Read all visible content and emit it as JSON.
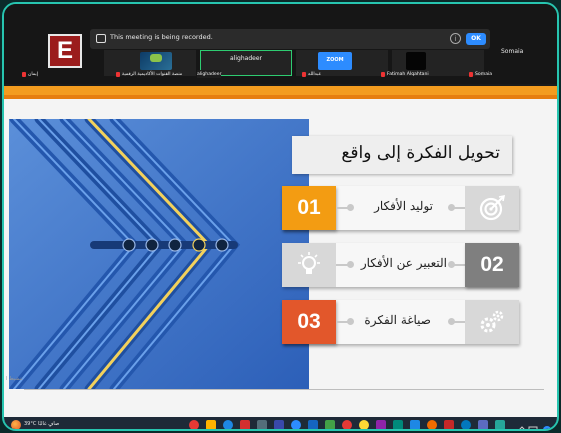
{
  "zoom": {
    "logo_letter": "E",
    "recording_notice": "This meeting is being recorded.",
    "info_symbol": "i",
    "ok_label": "OK",
    "tiles": [
      {
        "center_label": "",
        "name": "منصة القنوات الأكاديمية الرقمية"
      },
      {
        "center_label": "alighadeer",
        "name": "alighadeer"
      },
      {
        "center_label": "ZOOM",
        "name": "عبدالله"
      },
      {
        "center_label": "",
        "name": "Fatimah Alqahtani"
      },
      {
        "center_label": "Somaia",
        "name": "Somaia"
      }
    ],
    "left_name": "إيمان"
  },
  "slide": {
    "title": "تحويل الفكرة إلى واقع",
    "cards": [
      {
        "number": "01",
        "label": "توليد الأفكار",
        "color": "#f39c12",
        "icon": "target-icon"
      },
      {
        "number": "02",
        "label": "التعبير عن الأفكار",
        "color": "#7f7f7f",
        "icon": "lightbulb-icon"
      },
      {
        "number": "03",
        "label": "صياغة الفكرة",
        "color": "#e2572b",
        "icon": "gears-icon"
      }
    ],
    "watermark_text": "تنشيط ا"
  },
  "taskbar": {
    "weather": "39°C  صافٍ غالبًا"
  }
}
